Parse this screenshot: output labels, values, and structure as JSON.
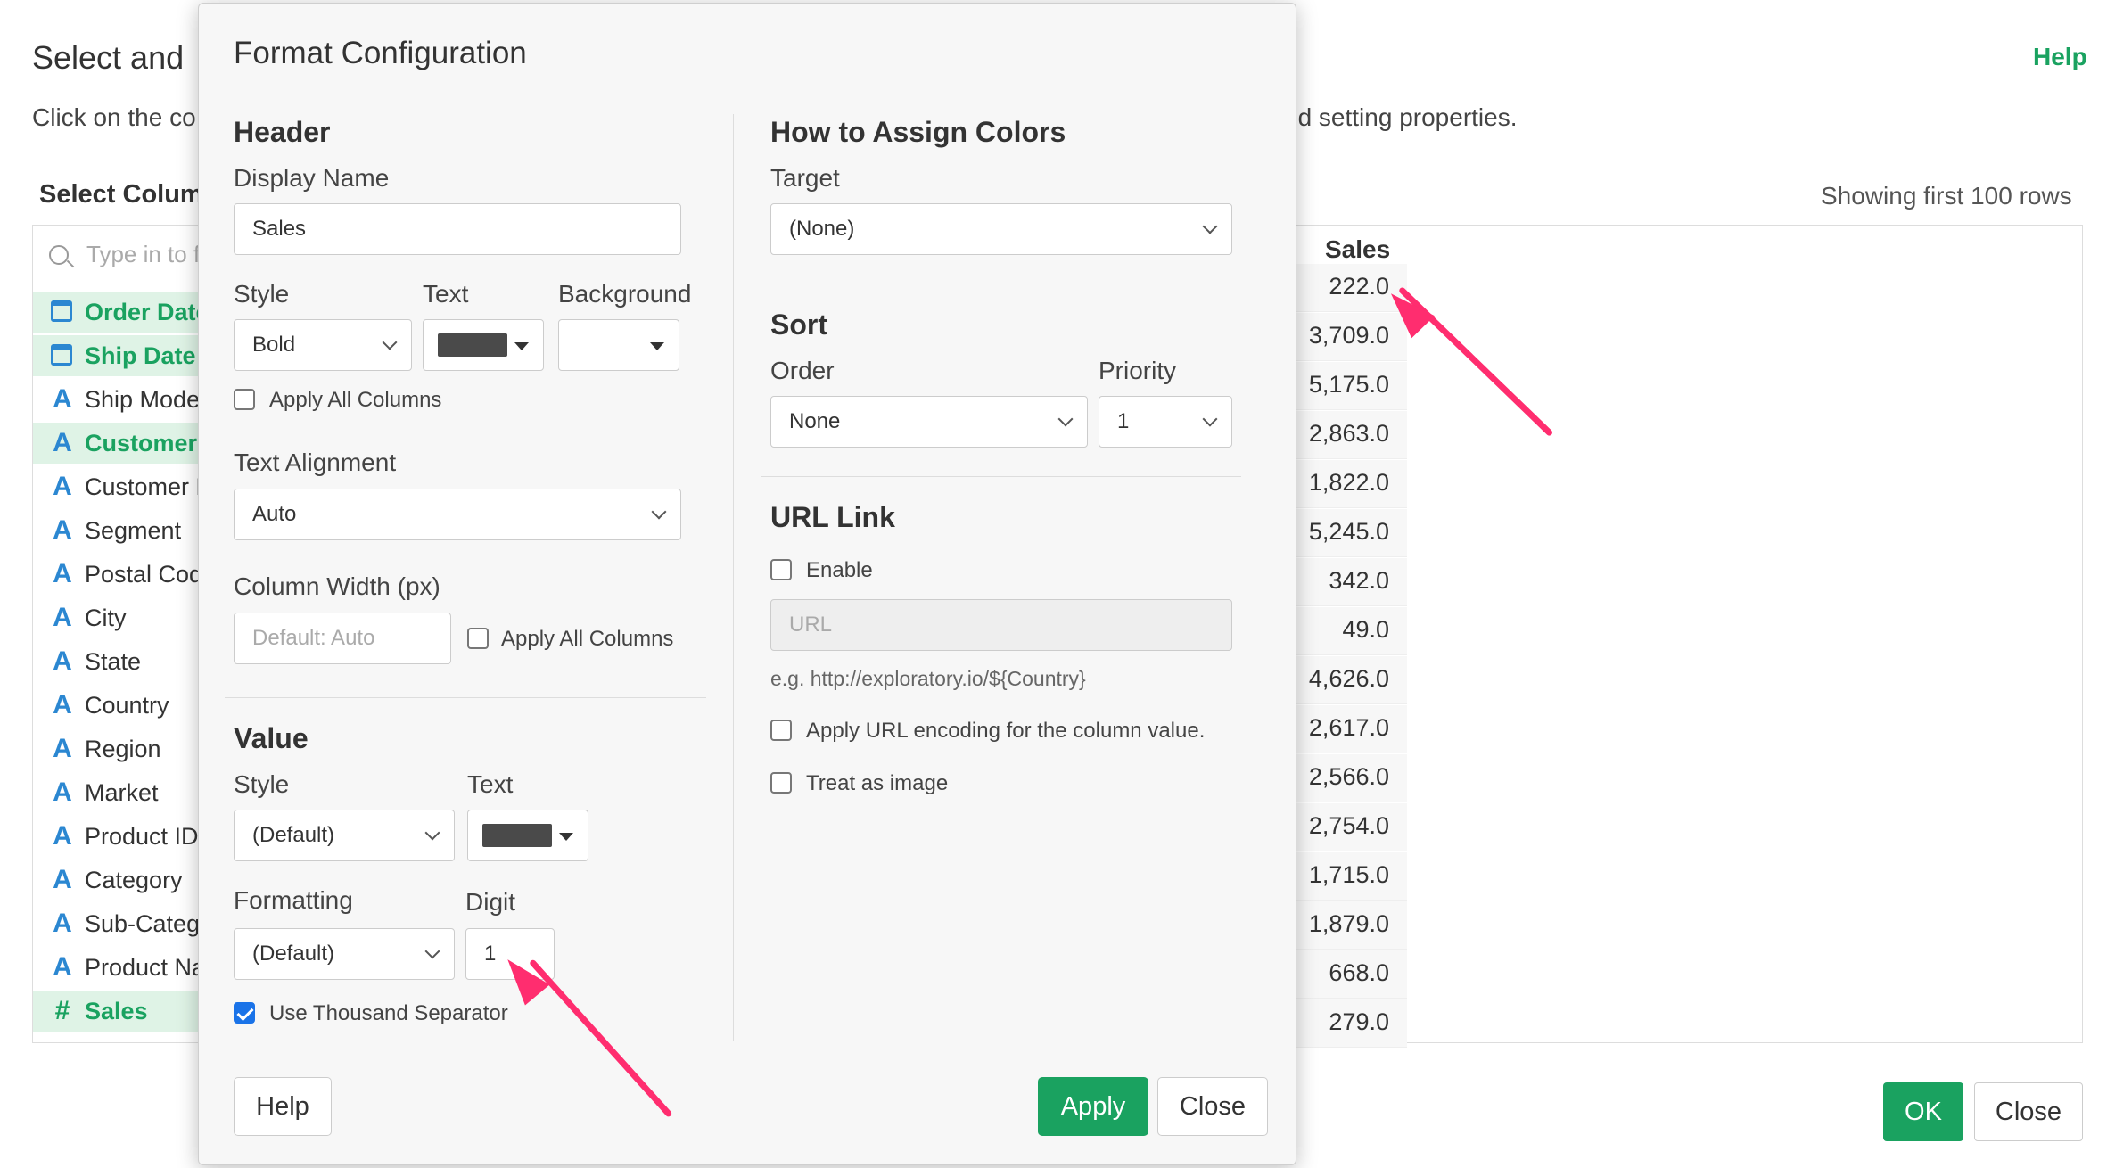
{
  "page": {
    "title": "Select and",
    "help": "Help",
    "description_left": "Click on the co",
    "description_right": "nd setting properties.",
    "select_columns": "Select Colum",
    "search_placeholder": "Type in to f",
    "showing_rows": "Showing first 100 rows",
    "ok_label": "OK",
    "close_label": "Close"
  },
  "columns": [
    {
      "label": "Order Date",
      "icon": "calendar-icon",
      "selected": true
    },
    {
      "label": "Ship Date",
      "icon": "calendar-icon",
      "selected": true
    },
    {
      "label": "Ship Mode",
      "icon": "text-type-icon",
      "selected": false
    },
    {
      "label": "Customer",
      "icon": "text-type-icon",
      "selected": true
    },
    {
      "label": "Customer N",
      "icon": "text-type-icon",
      "selected": false
    },
    {
      "label": "Segment",
      "icon": "text-type-icon",
      "selected": false
    },
    {
      "label": "Postal Cod",
      "icon": "text-type-icon",
      "selected": false
    },
    {
      "label": "City",
      "icon": "text-type-icon",
      "selected": false
    },
    {
      "label": "State",
      "icon": "text-type-icon",
      "selected": false
    },
    {
      "label": "Country",
      "icon": "text-type-icon",
      "selected": false
    },
    {
      "label": "Region",
      "icon": "text-type-icon",
      "selected": false
    },
    {
      "label": "Market",
      "icon": "text-type-icon",
      "selected": false
    },
    {
      "label": "Product ID",
      "icon": "text-type-icon",
      "selected": false
    },
    {
      "label": "Category",
      "icon": "text-type-icon",
      "selected": false
    },
    {
      "label": "Sub-Categ",
      "icon": "text-type-icon",
      "selected": false
    },
    {
      "label": "Product Na",
      "icon": "text-type-icon",
      "selected": false
    },
    {
      "label": "Sales",
      "icon": "number-type-icon",
      "selected": true
    }
  ],
  "table": {
    "header": "Sales",
    "values": [
      "222.0",
      "3,709.0",
      "5,175.0",
      "2,863.0",
      "1,822.0",
      "5,245.0",
      "342.0",
      "49.0",
      "4,626.0",
      "2,617.0",
      "2,566.0",
      "2,754.0",
      "1,715.0",
      "1,879.0",
      "668.0",
      "279.0"
    ]
  },
  "modal": {
    "title": "Format Configuration",
    "header_section": "Header",
    "display_name_label": "Display Name",
    "display_name_value": "Sales",
    "style_label": "Style",
    "style_value": "Bold",
    "text_label": "Text",
    "background_label": "Background",
    "text_color": "#4a4a4a",
    "apply_all_columns": "Apply All Columns",
    "text_alignment_label": "Text Alignment",
    "text_alignment_value": "Auto",
    "column_width_label": "Column Width (px)",
    "column_width_placeholder": "Default: Auto",
    "apply_all_columns_2": "Apply All Columns",
    "value_section": "Value",
    "value_style_label": "Style",
    "value_style_value": "(Default)",
    "value_text_label": "Text",
    "formatting_label": "Formatting",
    "formatting_value": "(Default)",
    "digit_label": "Digit",
    "digit_value": "1",
    "thousand_separator": "Use Thousand Separator",
    "thousand_separator_checked": true,
    "colors_section": "How to Assign Colors",
    "target_label": "Target",
    "target_value": "(None)",
    "sort_section": "Sort",
    "order_label": "Order",
    "order_value": "None",
    "priority_label": "Priority",
    "priority_value": "1",
    "url_section": "URL Link",
    "enable_label": "Enable",
    "url_placeholder": "URL",
    "url_example": "e.g. http://exploratory.io/${Country}",
    "url_encoding_label": "Apply URL encoding for the column value.",
    "treat_as_image_label": "Treat as image",
    "help_button": "Help",
    "apply_button": "Apply",
    "close_button": "Close"
  },
  "colors": {
    "accent": "#1aa260",
    "arrow": "#ff2d6f",
    "type_icon": "#2b87d1"
  }
}
